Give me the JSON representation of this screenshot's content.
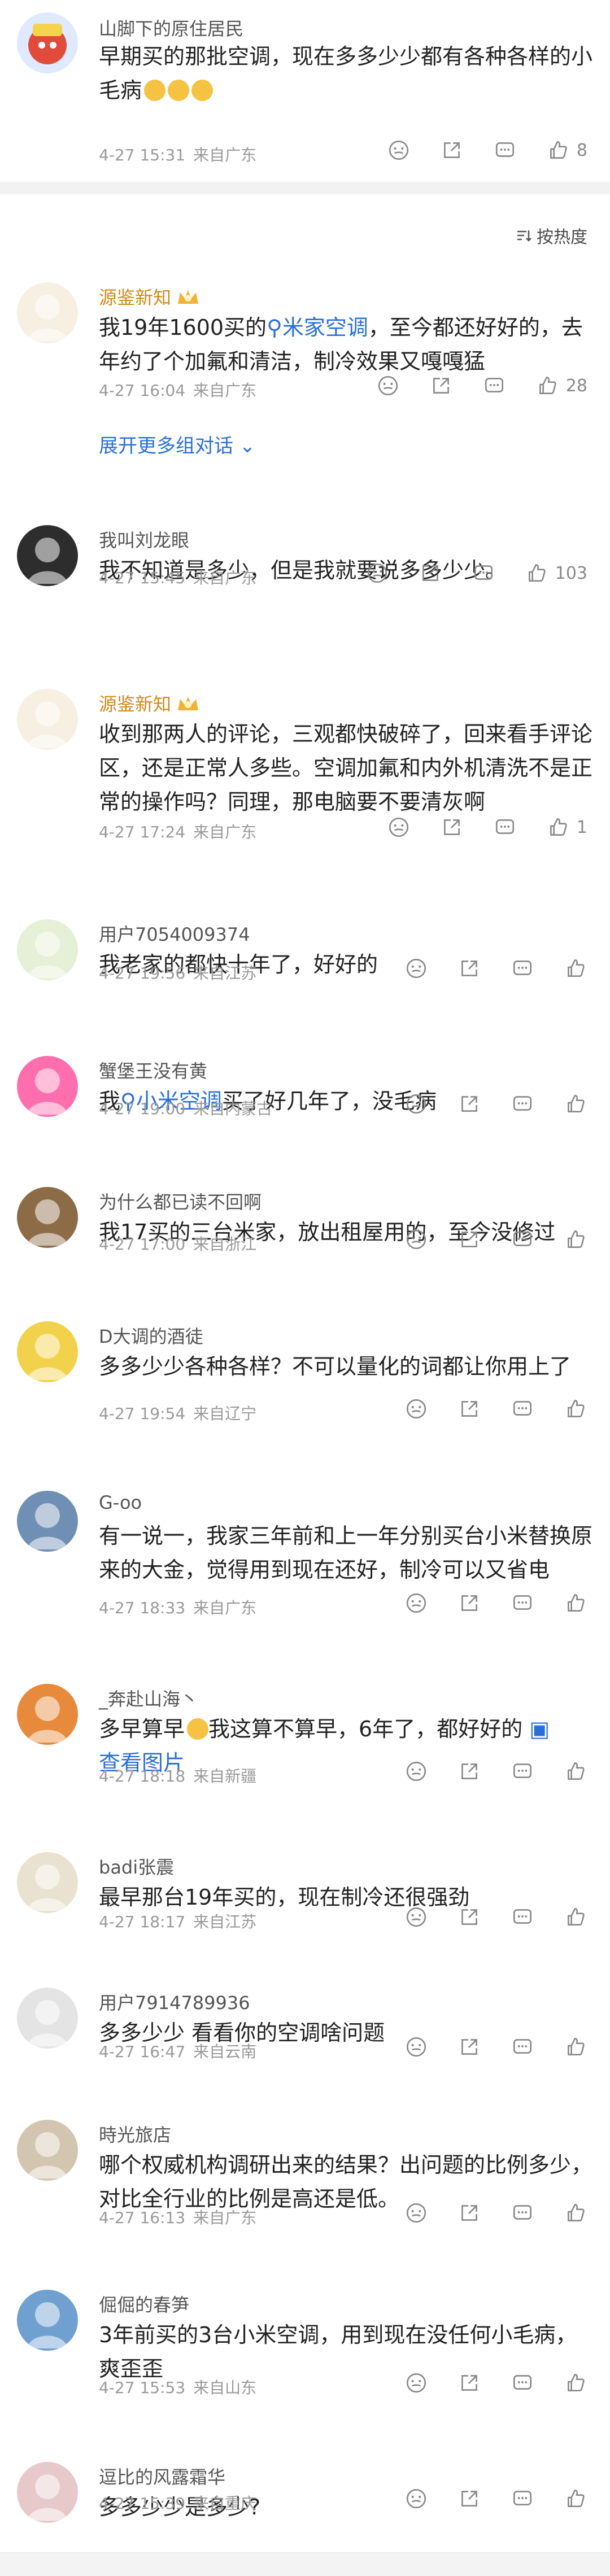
{
  "top_post": {
    "author": "山脚下的原住居民",
    "text": "早期买的那批空调，现在多多少少都有各种各样的小毛病",
    "time": "4-27 15:31",
    "loc": "来自广东",
    "likes": "8"
  },
  "sort_label": "按热度",
  "comments": [
    {
      "name": "源鉴新知",
      "gold": true,
      "crown": true,
      "text_pre": "我19年1600买的",
      "chip": "米家空调",
      "text_post": "，至今都还好好的，去年约了个加氟和清洁，制冷效果又嘎嘎猛",
      "time": "4-27 16:04",
      "loc": "来自广东",
      "likes": "28",
      "expand": "展开更多组对话"
    },
    {
      "name": "我叫刘龙眼",
      "gold": false,
      "text": "我不知道是多少，但是我就要说多多少少。",
      "time": "4-27 15:45",
      "loc": "来自广东",
      "likes": "103"
    },
    {
      "name": "源鉴新知",
      "gold": true,
      "crown": true,
      "text": "收到那两人的评论，三观都快破碎了，回来看手评论区，还是正常人多些。空调加氟和内外机清洗不是正常的操作吗？同理，那电脑要不要清灰啊",
      "time": "4-27 17:24",
      "loc": "来自广东",
      "likes": "1"
    },
    {
      "name": "用户7054009374",
      "text": "我老家的都快十年了，好好的",
      "time": "4-27 19:56",
      "loc": "来自江苏",
      "likes": ""
    },
    {
      "name": "蟹堡王没有黄",
      "text_pre": "我",
      "chip": "小米空调",
      "text_post": "买了好几年了，没毛病",
      "time": "4-27 19:00",
      "loc": "来自内蒙古",
      "likes": ""
    },
    {
      "name": "为什么都已读不回啊",
      "text": "我17买的三台米家，放出租屋用的，至今没修过",
      "time": "4-27 17:00",
      "loc": "来自浙江",
      "likes": ""
    },
    {
      "name": "D大调的酒徒",
      "text": "多多少少各种各样？不可以量化的词都让你用上了",
      "time": "4-27 19:54",
      "loc": "来自辽宁",
      "likes": ""
    },
    {
      "name": "G-oo",
      "text": "有一说一，我家三年前和上一年分别买台小米替换原来的大金，觉得用到现在还好，制冷可以又省电",
      "time": "4-27 18:33",
      "loc": "来自广东",
      "likes": ""
    },
    {
      "name": "_奔赴山海丶",
      "text": "多早算早",
      "text_post2": "我这算不算早，6年了，都好好的",
      "link": "查看图片",
      "time": "4-27 18:18",
      "loc": "来自新疆",
      "likes": ""
    },
    {
      "name": "badi张震",
      "text": "最早那台19年买的，现在制冷还很强劲",
      "time": "4-27 18:17",
      "loc": "来自江苏",
      "likes": ""
    },
    {
      "name": "用户7914789936",
      "text": "多多少少 看看你的空调啥问题",
      "time": "4-27 16:47",
      "loc": "来自云南",
      "likes": ""
    },
    {
      "name": "時光旅店",
      "text": "哪个权威机构调研出来的结果？出问题的比例多少，对比全行业的比例是高还是低。",
      "time": "4-27 16:13",
      "loc": "来自广东",
      "likes": ""
    },
    {
      "name": "倔倔的春笋",
      "text": "3年前买的3台小米空调，用到现在没任何小毛病，爽歪歪",
      "time": "4-27 15:53",
      "loc": "来自山东",
      "likes": ""
    },
    {
      "name": "逗比的风露霜华",
      "text": "多多少少是多少?",
      "time": "4-27 15:39",
      "loc": "来自重庆",
      "likes": ""
    }
  ],
  "icons": {
    "face": "emoji-face-icon",
    "share": "share-icon",
    "comment": "comment-icon",
    "like": "thumb-up-icon",
    "sort": "sort-icon",
    "crown": "crown-badge-icon",
    "image": "image-icon"
  }
}
